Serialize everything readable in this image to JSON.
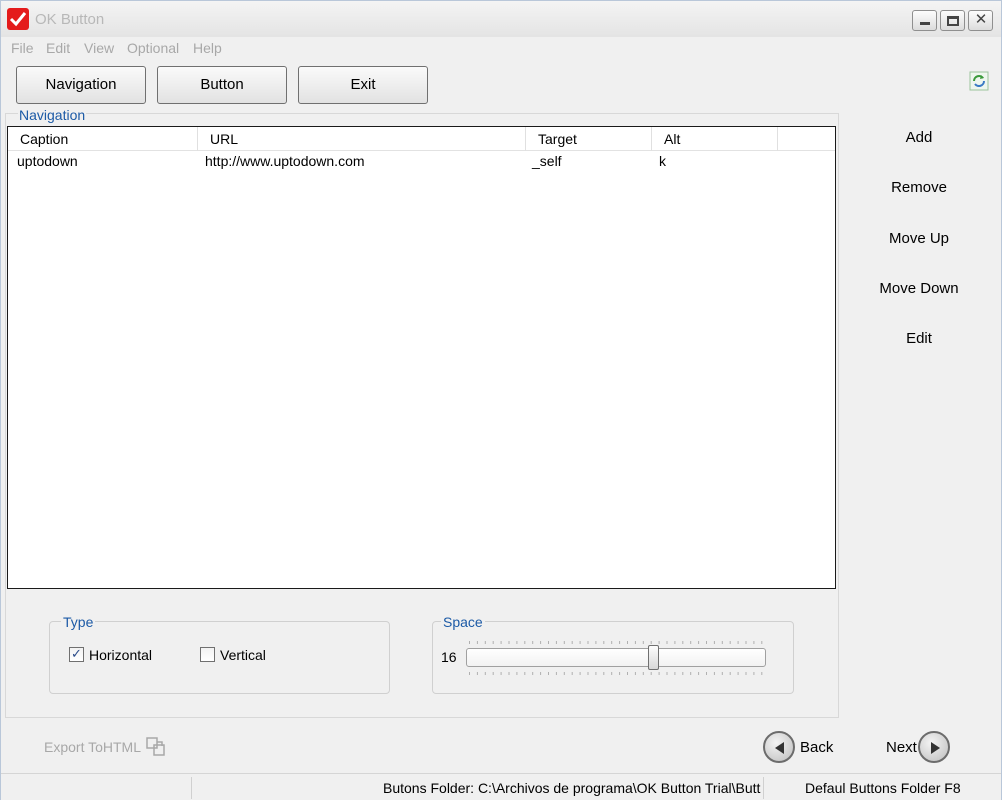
{
  "window": {
    "title": "OK Button"
  },
  "menu": [
    "File",
    "Edit",
    "View",
    "Optional",
    "Help"
  ],
  "toolbar": {
    "buttons": [
      "Navigation",
      "Button",
      "Exit"
    ]
  },
  "navigation_panel": {
    "legend": "Navigation",
    "columns": [
      "Caption",
      "URL",
      "Target",
      "Alt"
    ],
    "rows": [
      {
        "caption": "uptodown",
        "url": "http://www.uptodown.com",
        "target": "_self",
        "alt": "k"
      }
    ]
  },
  "side_actions": [
    "Add",
    "Remove",
    "Move Up",
    "Move Down",
    "Edit"
  ],
  "type_group": {
    "legend": "Type",
    "horizontal_label": "Horizontal",
    "horizontal_checked": true,
    "vertical_label": "Vertical",
    "vertical_checked": false
  },
  "space_group": {
    "legend": "Space",
    "value": "16",
    "slider_fraction": 0.63
  },
  "bottom": {
    "export_label": "Export ToHTML",
    "back_label": "Back",
    "next_label": "Next"
  },
  "status": {
    "buttons_folder": "Butons Folder: C:\\Archivos de programa\\OK Button Trial\\Button",
    "default_folder": "Defaul Buttons Folder F8"
  }
}
